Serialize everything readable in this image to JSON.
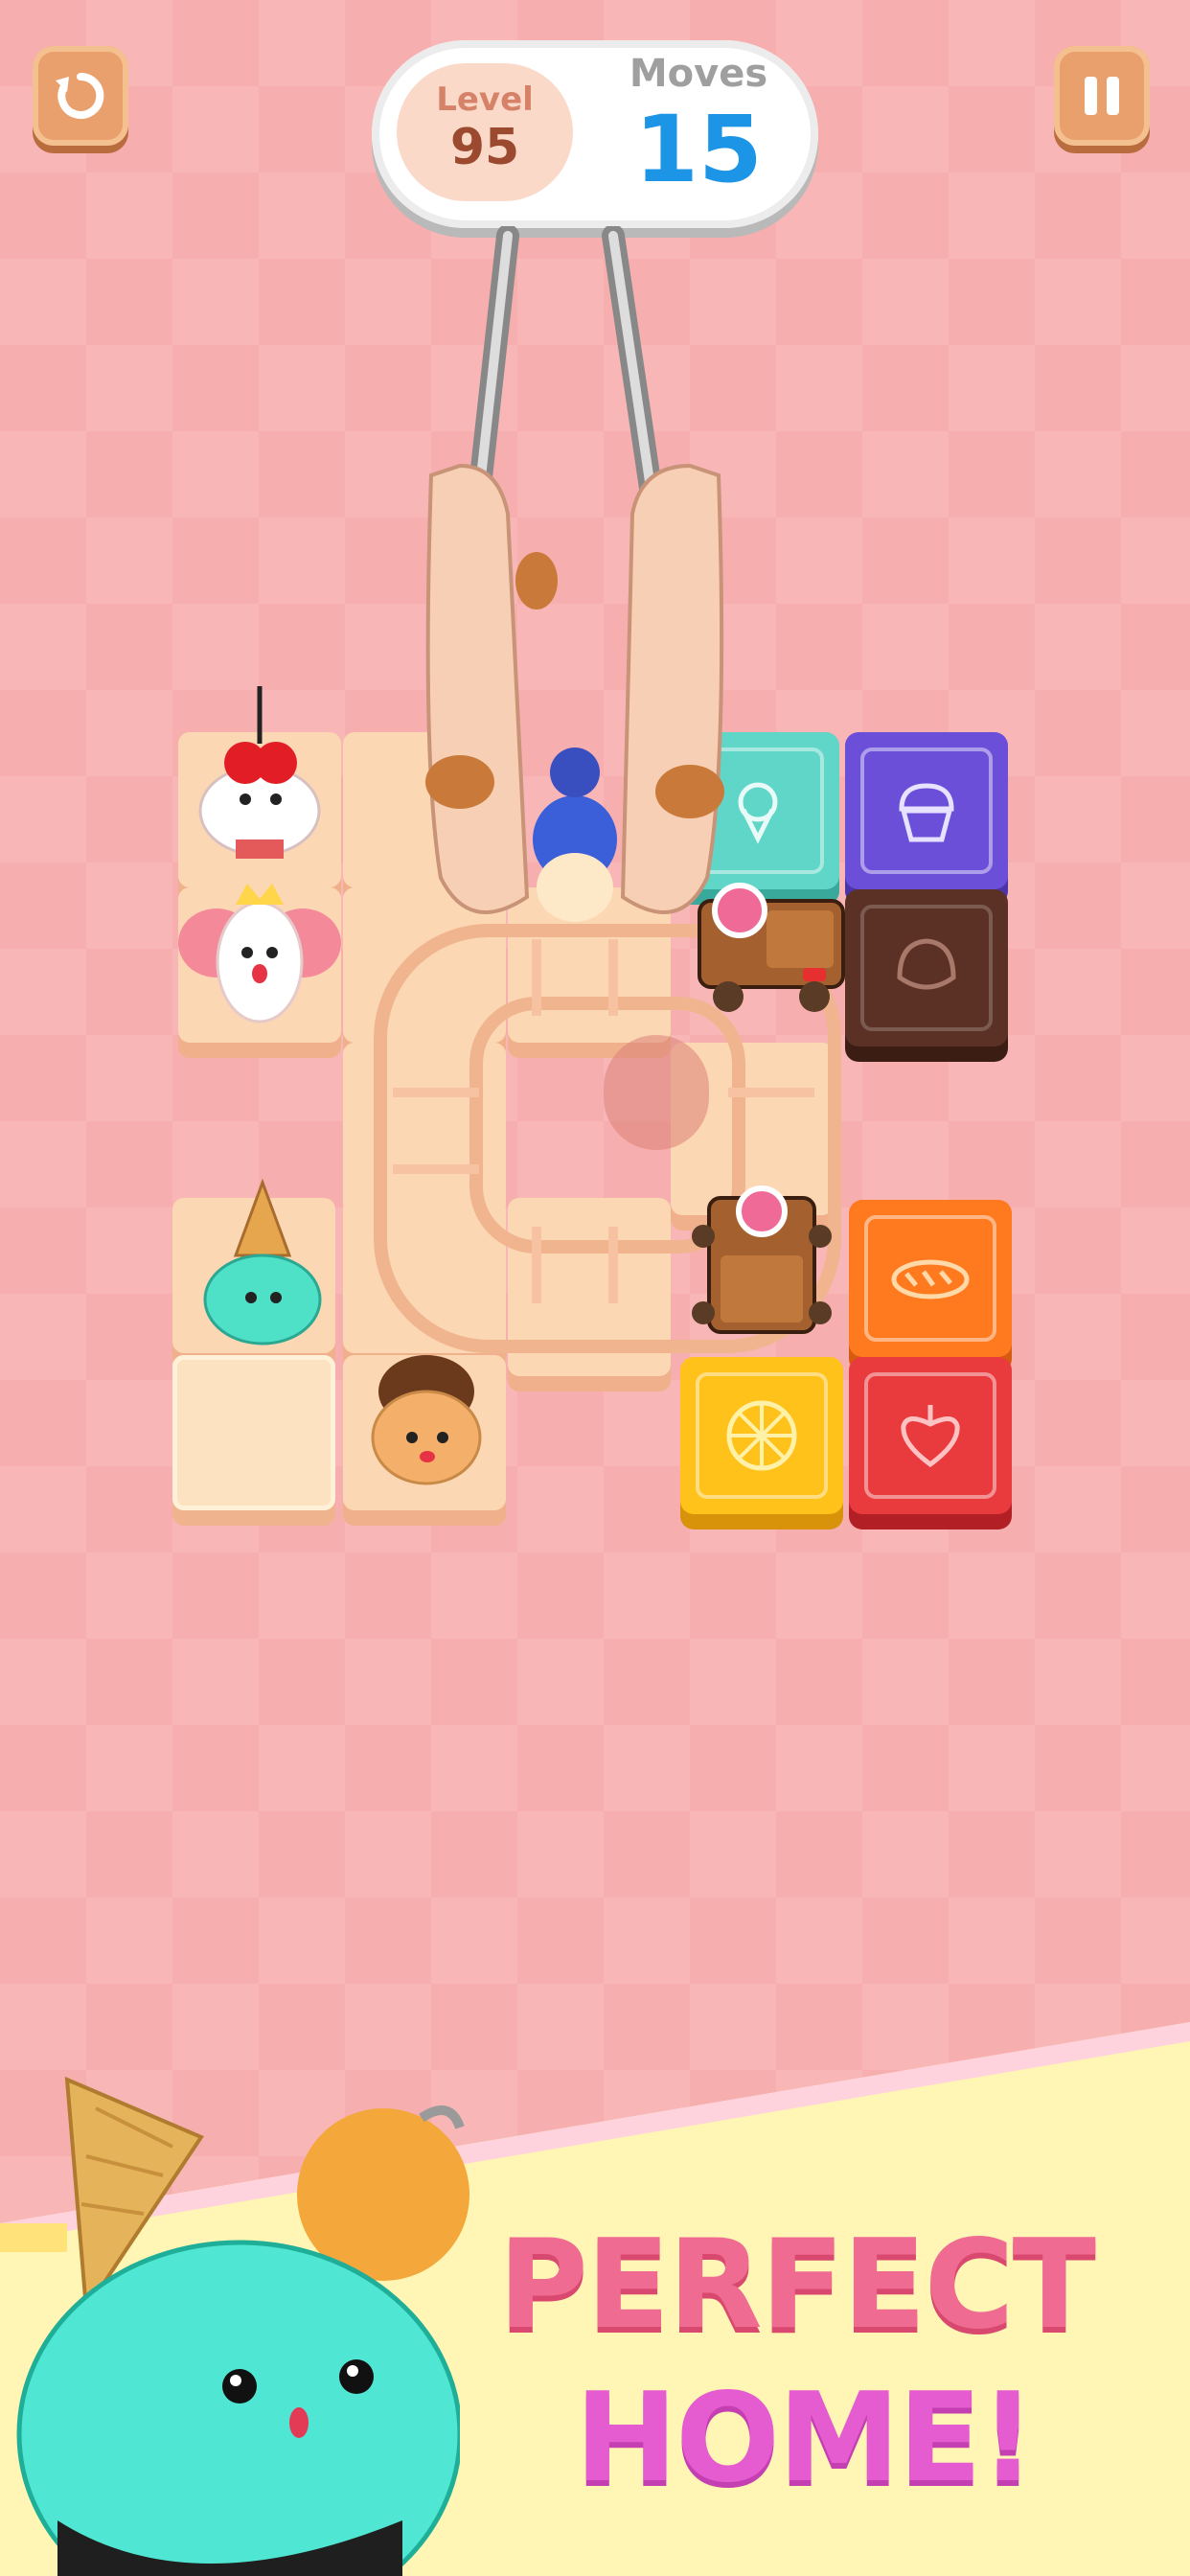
{
  "hud": {
    "level_label": "Level",
    "level_value": "95",
    "moves_label": "Moves",
    "moves_value": "15"
  },
  "buttons": {
    "restart_icon": "restart-icon",
    "pause_icon": "pause-icon"
  },
  "board": {
    "target_tiles": [
      {
        "icon": "ice-cream-icon",
        "color": "#5fd6c7"
      },
      {
        "icon": "cupcake-icon",
        "color": "#6b4fd8"
      },
      {
        "icon": "chestnut-icon",
        "color": "#5a3124"
      },
      {
        "icon": "sushi-icon",
        "color": "#ff7a1f"
      },
      {
        "icon": "lemon-icon",
        "color": "#ffc21a"
      },
      {
        "icon": "heart-fruit-icon",
        "color": "#e93a3d"
      }
    ]
  },
  "banner": {
    "line1": "PERFECT",
    "line2": "HOME!"
  },
  "colors": {
    "background": "#f7aeae",
    "accent_blue": "#1d95e6",
    "banner_pink": "#f06b91",
    "banner_magenta": "#e55bd0"
  }
}
